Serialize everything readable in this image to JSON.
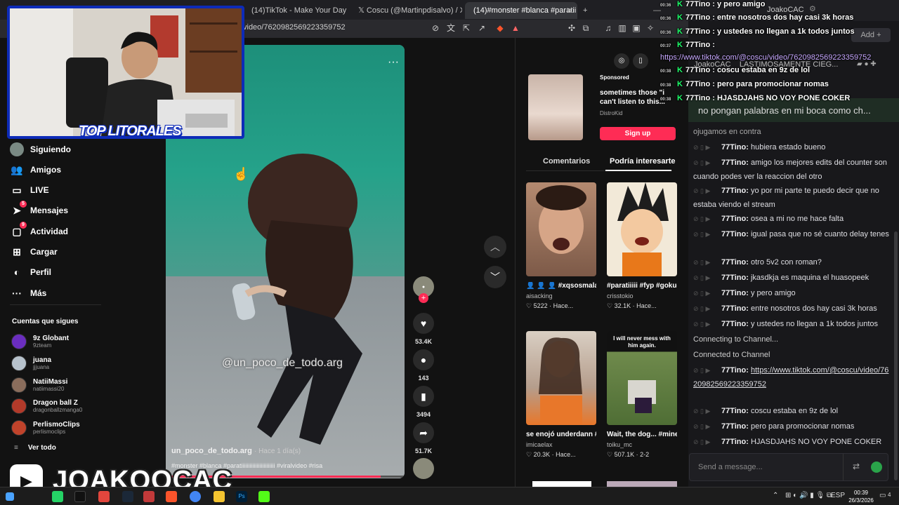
{
  "browser": {
    "tabs": [
      {
        "label": "(14)TikTok - Make Your Day"
      },
      {
        "label": "Coscu (@Martinpdisalvo) / X"
      },
      {
        "label": "(14)#monster #blanca #paratii",
        "active": true
      }
    ],
    "url": "video/7620982569223359752",
    "chat_tab": "JoakoCAC"
  },
  "tiktok": {
    "nav": [
      {
        "label": "Siguiendo",
        "icon": "following-avatar"
      },
      {
        "label": "Amigos",
        "icon": "friends-icon"
      },
      {
        "label": "LIVE",
        "icon": "live-icon"
      },
      {
        "label": "Mensajes",
        "icon": "messages-icon",
        "badge": "5"
      },
      {
        "label": "Actividad",
        "icon": "activity-icon",
        "badge": "9"
      },
      {
        "label": "Cargar",
        "icon": "upload-icon"
      },
      {
        "label": "Perfil",
        "icon": "profile-icon"
      },
      {
        "label": "Más",
        "icon": "more-icon"
      }
    ],
    "following_title": "Cuentas que sigues",
    "following": [
      {
        "name": "9z Globant",
        "handle": "9zteam",
        "color": "#6a2dbf"
      },
      {
        "name": "juana",
        "handle": "jjjuana",
        "color": "#b7c2cc"
      },
      {
        "name": "NatiiMassi",
        "handle": "natiimassi20",
        "color": "#8a6d5c"
      },
      {
        "name": "Dragon ball Z",
        "handle": "dragonballzmanga0",
        "color": "#b23a2a"
      },
      {
        "name": "PerlismoClips",
        "handle": "perlismoclips",
        "color": "#c0432b"
      }
    ],
    "see_all": "Ver todo",
    "video": {
      "watermark": "@un_poco_de_todo.arg",
      "username": "un_poco_de_todo.arg",
      "time": "Hace 1 día(s)",
      "tags": "#monster #blanca #paratiiiiiiiiiiiiiiiiiiiiiiii #viralvideo #risa",
      "progress": 0.9
    },
    "actions": {
      "likes": "53.4K",
      "comments": "143",
      "saves": "3494",
      "shares": "51.7K"
    },
    "ad": {
      "label": "Sponsored",
      "text": "sometimes those \"i can't listen to this...",
      "brand": "DistroKid",
      "cta": "Sign up"
    },
    "tabs": [
      "Comentarios",
      "Podría interesarte"
    ],
    "cards": [
      {
        "title": "👤 👤 👤 #xqsosmala...",
        "author": "aisacking",
        "meta": "♡ 5222 · Hace...",
        "thumb_text": ""
      },
      {
        "title": "#paratiiiii #fyp #goku#animeedi...",
        "author": "crisstokio",
        "meta": "♡ 32.1K · Hace...",
        "thumb_text": ""
      },
      {
        "title": "se enojó underdann #fyp...",
        "author": "imicaelax",
        "meta": "♡ 20.3K · Hace...",
        "thumb_text": ""
      },
      {
        "title": "Wait, the dog... #minecraft...",
        "author": "toiku_mc",
        "meta": "♡ 507.1K · 2-2",
        "thumb_text": "I will never mess with him again."
      }
    ]
  },
  "chat": {
    "header_tabs": [
      "JoakoCAC",
      "LASTIMOSAMENTE CIEG..."
    ],
    "add_label": "Add +",
    "pinned": "no pongan palabras en mi boca como ch...",
    "messages": [
      {
        "user": "",
        "text": "ojugamos en contra"
      },
      {
        "user": "77Tino:",
        "text": "hubiera estado bueno"
      },
      {
        "user": "77Tino:",
        "text": "amigo los mejores edits del counter son cuando podes ver la reaccion del otro"
      },
      {
        "user": "77Tino:",
        "text": "yo por mi parte te puedo decir que no estaba viendo el stream"
      },
      {
        "user": "77Tino:",
        "text": "osea a mi no me hace falta"
      },
      {
        "user": "77Tino:",
        "text": "igual pasa que no sé cuanto delay tenes"
      },
      {
        "user": "77Tino:",
        "text": "otro 5v2 con roman?"
      },
      {
        "user": "77Tino:",
        "text": "jkasdkja es maquina el huasopeek"
      },
      {
        "user": "77Tino:",
        "text": "y pero amigo"
      },
      {
        "user": "77Tino:",
        "text": "entre nosotros dos hay casi 3k horas"
      },
      {
        "user": "77Tino:",
        "text": "y ustedes no llegan a 1k todos juntos"
      },
      {
        "user": "",
        "text": "Connecting to Channel..."
      },
      {
        "user": "",
        "text": "Connected to Channel"
      },
      {
        "user": "77Tino:",
        "text": "https://www.tiktok.com/@coscu/video/7620982569223359752"
      },
      {
        "user": "77Tino:",
        "text": "coscu estaba en 9z de lol"
      },
      {
        "user": "77Tino:",
        "text": "pero para promocionar nomas"
      },
      {
        "user": "77Tino:",
        "text": "HJASDJAHS NO VOY PONE COKER"
      }
    ],
    "input_placeholder": "Send a message..."
  },
  "overlay": {
    "messages": [
      {
        "time": "00:36",
        "text": "77Tino : y pero amigo"
      },
      {
        "time": "00:36",
        "text": "77Tino : entre nosotros dos hay casi 3k horas"
      },
      {
        "time": "00:36",
        "text": "77Tino : y ustedes no llegan a 1k todos juntos"
      },
      {
        "time": "00:37",
        "text": "77Tino :"
      },
      {
        "time": "",
        "text": "https://www.tiktok.com/@coscu/video/7620982569223359752"
      },
      {
        "time": "00:38",
        "text": "77Tino : coscu estaba en 9z de lol"
      },
      {
        "time": "00:38",
        "text": "77Tino : pero para promocionar nomas"
      },
      {
        "time": "00:38",
        "text": "77Tino : HJASDJAHS NO VOY PONE COKER"
      }
    ]
  },
  "stream": {
    "cam_logo": "TOP LITORALES",
    "streamer": "JOAKOOCAC"
  },
  "taskbar": {
    "lang": "ESP",
    "time": "00:39",
    "date": "26/3/2026",
    "notifications": "4"
  }
}
